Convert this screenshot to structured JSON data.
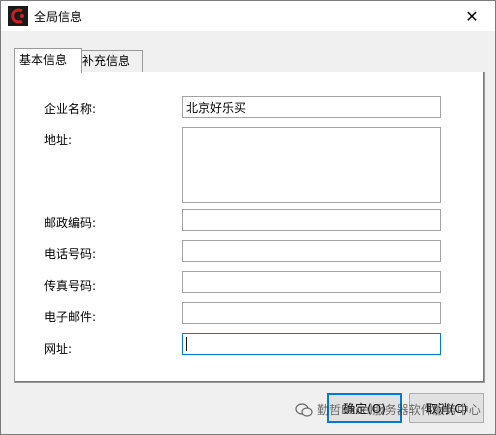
{
  "window": {
    "title": "全局信息",
    "close_glyph": "✕"
  },
  "tabs": [
    {
      "label": "基本信息",
      "active": true
    },
    {
      "label": "补充信息",
      "active": false
    }
  ],
  "form": {
    "company_name_label": "企业名称:",
    "company_name_value": "北京好乐买",
    "address_label": "地址:",
    "address_value": "",
    "postal_code_label": "邮政编码:",
    "postal_code_value": "",
    "phone_label": "电话号码:",
    "phone_value": "",
    "fax_label": "传真号码:",
    "fax_value": "",
    "email_label": "电子邮件:",
    "email_value": "",
    "website_label": "网址:",
    "website_value": ""
  },
  "buttons": {
    "ok_label": "确定(O)",
    "cancel_label": "取消(C)"
  },
  "watermark": {
    "text": "勤哲Excel服务器软件服务中心",
    "icon": "wechat-icon"
  },
  "colors": {
    "accent": "#0078d7",
    "logo_red": "#cc1f1f"
  }
}
